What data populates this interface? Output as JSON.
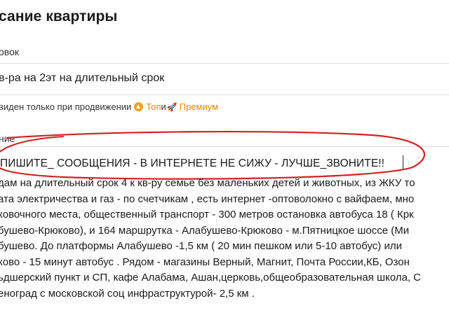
{
  "section": {
    "title": "сание квартиры"
  },
  "title_field": {
    "label": "овок",
    "value": "в-ра на 2эт на длительный срок"
  },
  "promo": {
    "text_before": "виден только при продвижении",
    "top_label": "Топ",
    "and": "и",
    "premium_label": "Премиум"
  },
  "description_field": {
    "label": "ние",
    "warning_line": "ПИШИТЕ_ СООБЩЕНИЯ - В ИНТЕРНЕТЕ НЕ СИЖУ - ЛУЧШЕ_ЗВОНИТЕ!!",
    "lines": [
      "дам на длительный срок 4 к кв-ру семье без маленьких детей и животных, из ЖКУ то",
      "ата электричества и газ - по счетчикам , есть интернет -оптоволокно с вайфаем, мно",
      "ковочного места, общественный транспорт - 300 метров остановка автобуса 18 ( Крк",
      "бушево-Крюково), и 164 маршрутка - Алабушево-Крюково - м.Пятницкое шоссе (Ми",
      "бушево. До платформы Алабушево -1,5 км ( 20 мин пешком или 5-10 автобус) или",
      "ково - 15 минут автобус . Рядом - магазины Верный, Магнит, Почта России,КБ, Озон",
      "ьдшерский пункт и СП, кафе Алабама, Ашан,церковь,общеобразовательная школа,  С",
      "еноград с московской соц инфраструктурой- 2,5 км ."
    ]
  },
  "colors": {
    "accent_orange": "#e08a00",
    "annotation_red": "#d42020",
    "border": "#dfe3e8"
  }
}
